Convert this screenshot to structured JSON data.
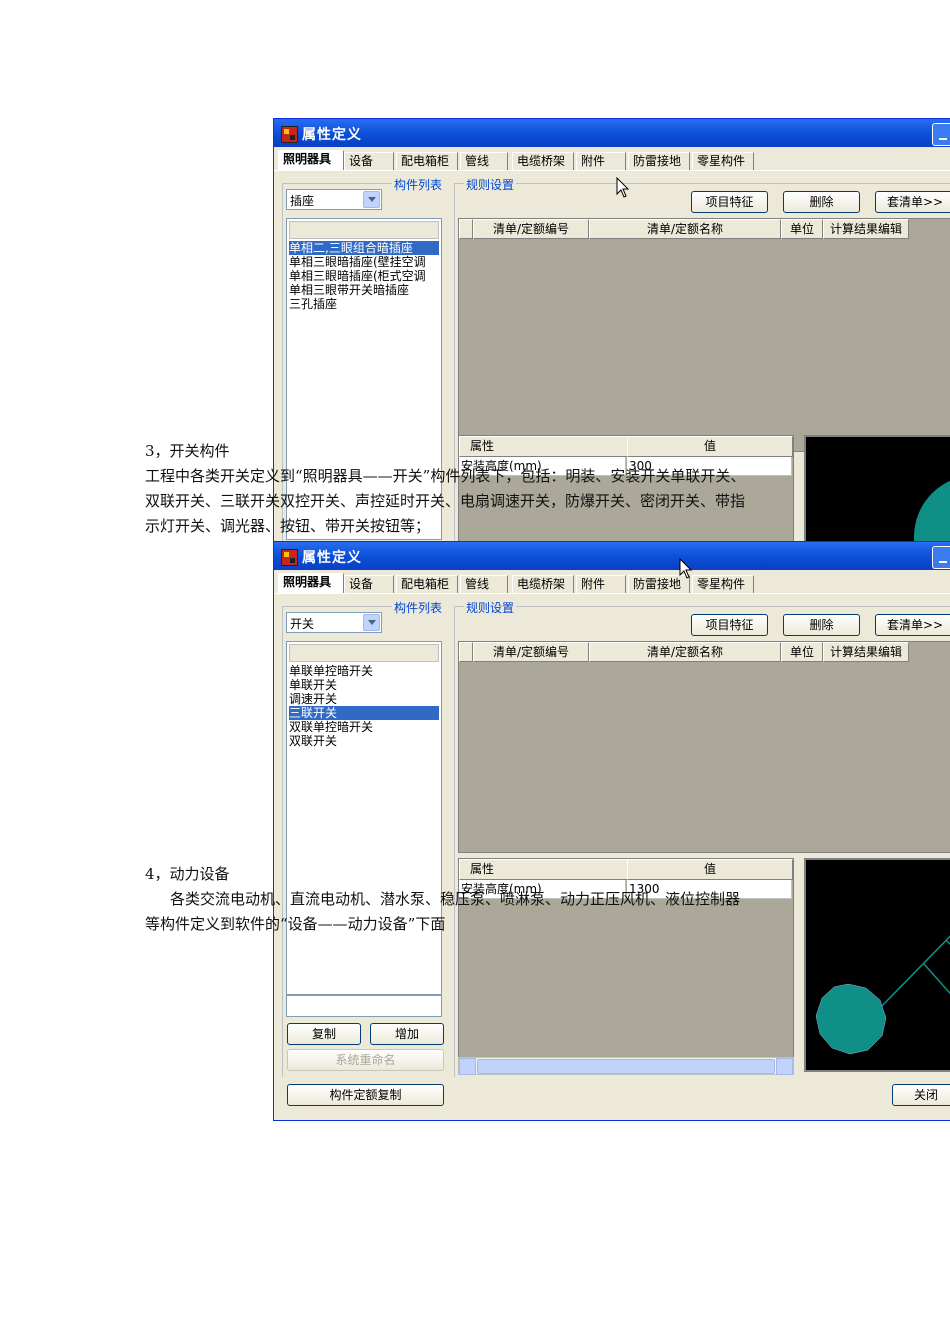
{
  "paragraphs": {
    "h3": "3，开关构件",
    "p3_line1": "工程中各类开关定义到“照明器具——开关”构件列表下，包括：明装、安装开关单联开关、",
    "p3_line2": "双联开关、三联开关双控开关、声控延时开关、电扇调速开关，防爆开关、密闭开关、带指",
    "p3_line3": "示灯开关、调光器、按钮、带开关按钮等；",
    "h4": "4，动力设备",
    "p4_line1": "各类交流电动机、直流电动机、潜水泵、稳压泵、喷淋泵、动力正压风机、液位控制器",
    "p4_line2": "等构件定义到软件的“设备——动力设备”下面"
  },
  "dialog1": {
    "title": "属性定义",
    "tabs": [
      "照明器具",
      "设备",
      "配电箱柜",
      "管线",
      "电缆桥架",
      "附件",
      "防雷接地",
      "零星构件"
    ],
    "component_list_label": "构件列表",
    "rule_settings_label": "规则设置",
    "category": "插座",
    "items": [
      "单相二,三眼组合暗插座",
      "单相三眼暗插座(壁挂空调",
      "单相三眼暗插座(柜式空调",
      "单相三眼带开关暗插座",
      "三孔插座"
    ],
    "selected_item": 0,
    "buttons": {
      "feature": "项目特征",
      "delete": "删除",
      "apply": "套清单>>"
    },
    "grid_headers": [
      "清单/定额编号",
      "清单/定额名称",
      "单位",
      "计算结果编辑"
    ],
    "prop_headers": [
      "属性",
      "值"
    ],
    "prop_name": "安装高度(mm)",
    "prop_value": "300"
  },
  "dialog2": {
    "title": "属性定义",
    "tabs": [
      "照明器具",
      "设备",
      "配电箱柜",
      "管线",
      "电缆桥架",
      "附件",
      "防雷接地",
      "零星构件"
    ],
    "component_list_label": "构件列表",
    "rule_settings_label": "规则设置",
    "category": "开关",
    "items": [
      "单联单控暗开关",
      "单联开关",
      "调速开关",
      "三联开关",
      "双联单控暗开关",
      "双联开关"
    ],
    "selected_item": 3,
    "buttons": {
      "feature": "项目特征",
      "delete": "删除",
      "apply": "套清单>>",
      "copy": "复制",
      "add": "增加",
      "rename": "系统重命名",
      "quota_copy": "构件定额复制",
      "close": "关闭"
    },
    "grid_headers": [
      "清单/定额编号",
      "清单/定额名称",
      "单位",
      "计算结果编辑"
    ],
    "prop_headers": [
      "属性",
      "值"
    ],
    "prop_name": "安装高度(mm)",
    "prop_value": "1300"
  },
  "colors": {
    "titlebar": "#0a4fd6",
    "face": "#ece9d8",
    "selection": "#316ac5",
    "preview_shape": "#0f8f86",
    "group_label": "#0046d5"
  }
}
